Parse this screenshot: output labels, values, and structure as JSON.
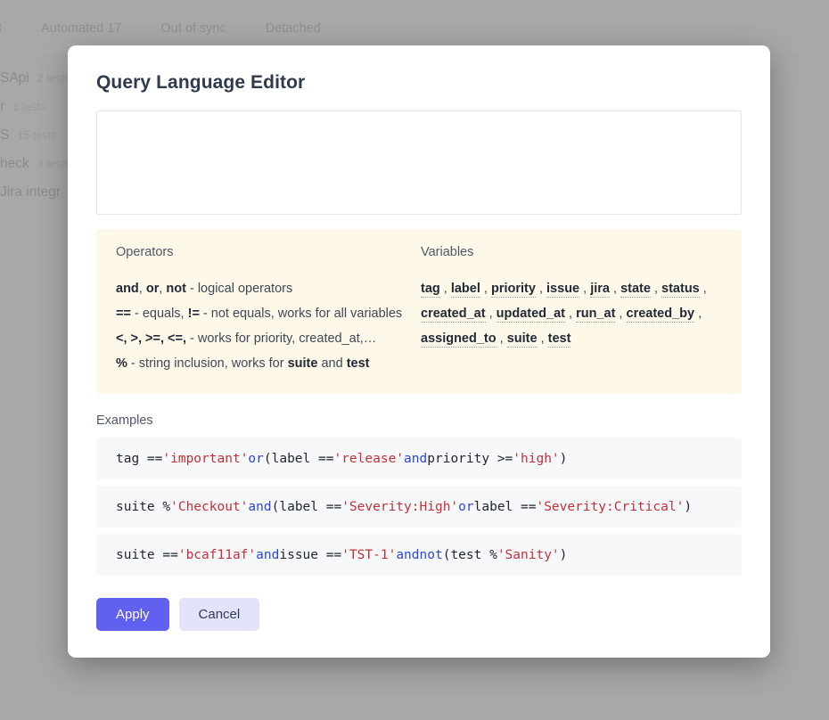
{
  "background": {
    "tabs": [
      {
        "label": "3"
      },
      {
        "label": "Automated 17"
      },
      {
        "label": "Out of sync"
      },
      {
        "label": "Detached"
      }
    ],
    "rows": [
      {
        "name": "SApi",
        "count": "2 tests"
      },
      {
        "name": "r",
        "count": "1 tests"
      },
      {
        "name": "S",
        "count": "15 tests"
      },
      {
        "name": "heck",
        "count": "4 tests"
      },
      {
        "name": "Jira integr",
        "count": ""
      }
    ]
  },
  "modal": {
    "title": "Query Language Editor",
    "query_input": {
      "value": "",
      "placeholder": ""
    },
    "help": {
      "operators_heading": "Operators",
      "variables_heading": "Variables",
      "operators": [
        {
          "parts": [
            {
              "text": "and",
              "bold": true
            },
            {
              "text": ", ",
              "bold": false
            },
            {
              "text": "or",
              "bold": true
            },
            {
              "text": ", ",
              "bold": false
            },
            {
              "text": "not",
              "bold": true
            },
            {
              "text": " - logical operators",
              "bold": false
            }
          ]
        },
        {
          "parts": [
            {
              "text": "==",
              "bold": true
            },
            {
              "text": " - equals, ",
              "bold": false
            },
            {
              "text": "!=",
              "bold": true
            },
            {
              "text": " - not equals, works for all variables",
              "bold": false
            }
          ]
        },
        {
          "parts": [
            {
              "text": "<, >, >=, <=,",
              "bold": true
            },
            {
              "text": " - works for priority, created_at,…",
              "bold": false
            }
          ]
        },
        {
          "parts": [
            {
              "text": "%",
              "bold": true
            },
            {
              "text": " - string inclusion, works for ",
              "bold": false
            },
            {
              "text": "suite",
              "bold": true
            },
            {
              "text": " and ",
              "bold": false
            },
            {
              "text": "test",
              "bold": true
            }
          ]
        }
      ],
      "variables": [
        [
          "tag",
          "label",
          "priority",
          "issue",
          "jira",
          "state",
          "status"
        ],
        [
          "created_at",
          "updated_at",
          "run_at",
          "created_by"
        ],
        [
          "assigned_to",
          "suite",
          "test"
        ]
      ],
      "variable_separator": ","
    },
    "examples_heading": "Examples",
    "examples": [
      {
        "tokens": [
          {
            "t": "tag == ",
            "c": "plain"
          },
          {
            "t": "'important'",
            "c": "str"
          },
          {
            "t": " ",
            "c": "plain"
          },
          {
            "t": "or",
            "c": "kw"
          },
          {
            "t": " (label == ",
            "c": "plain"
          },
          {
            "t": "'release'",
            "c": "str"
          },
          {
            "t": " ",
            "c": "plain"
          },
          {
            "t": "and",
            "c": "kw"
          },
          {
            "t": " priority >= ",
            "c": "plain"
          },
          {
            "t": "'high'",
            "c": "str"
          },
          {
            "t": ")",
            "c": "plain"
          }
        ]
      },
      {
        "tokens": [
          {
            "t": "suite % ",
            "c": "plain"
          },
          {
            "t": "'Checkout'",
            "c": "str"
          },
          {
            "t": " ",
            "c": "plain"
          },
          {
            "t": "and",
            "c": "kw"
          },
          {
            "t": " (label == ",
            "c": "plain"
          },
          {
            "t": "'Severity:High'",
            "c": "str"
          },
          {
            "t": " ",
            "c": "plain"
          },
          {
            "t": "or",
            "c": "kw"
          },
          {
            "t": " label == ",
            "c": "plain"
          },
          {
            "t": "'Severity:Critical'",
            "c": "str"
          },
          {
            "t": ")",
            "c": "plain"
          }
        ]
      },
      {
        "tokens": [
          {
            "t": "suite == ",
            "c": "plain"
          },
          {
            "t": "'bcaf11af'",
            "c": "str"
          },
          {
            "t": " ",
            "c": "plain"
          },
          {
            "t": "and",
            "c": "kw"
          },
          {
            "t": " issue == ",
            "c": "plain"
          },
          {
            "t": "'TST-1'",
            "c": "str"
          },
          {
            "t": " ",
            "c": "plain"
          },
          {
            "t": "and",
            "c": "kw"
          },
          {
            "t": " ",
            "c": "plain"
          },
          {
            "t": "not",
            "c": "kw"
          },
          {
            "t": " (test % ",
            "c": "plain"
          },
          {
            "t": "'Sanity'",
            "c": "str"
          },
          {
            "t": ")",
            "c": "plain"
          }
        ]
      }
    ],
    "apply_label": "Apply",
    "cancel_label": "Cancel"
  },
  "colors": {
    "accent": "#6260f0",
    "cancel_bg": "#e3e4fb",
    "help_panel_bg": "#fdf8e7",
    "example_bg": "#f7f8fa",
    "string_token": "#c5303a",
    "keyword_token": "#2b46e8",
    "overlay": "#9a9a9a"
  }
}
